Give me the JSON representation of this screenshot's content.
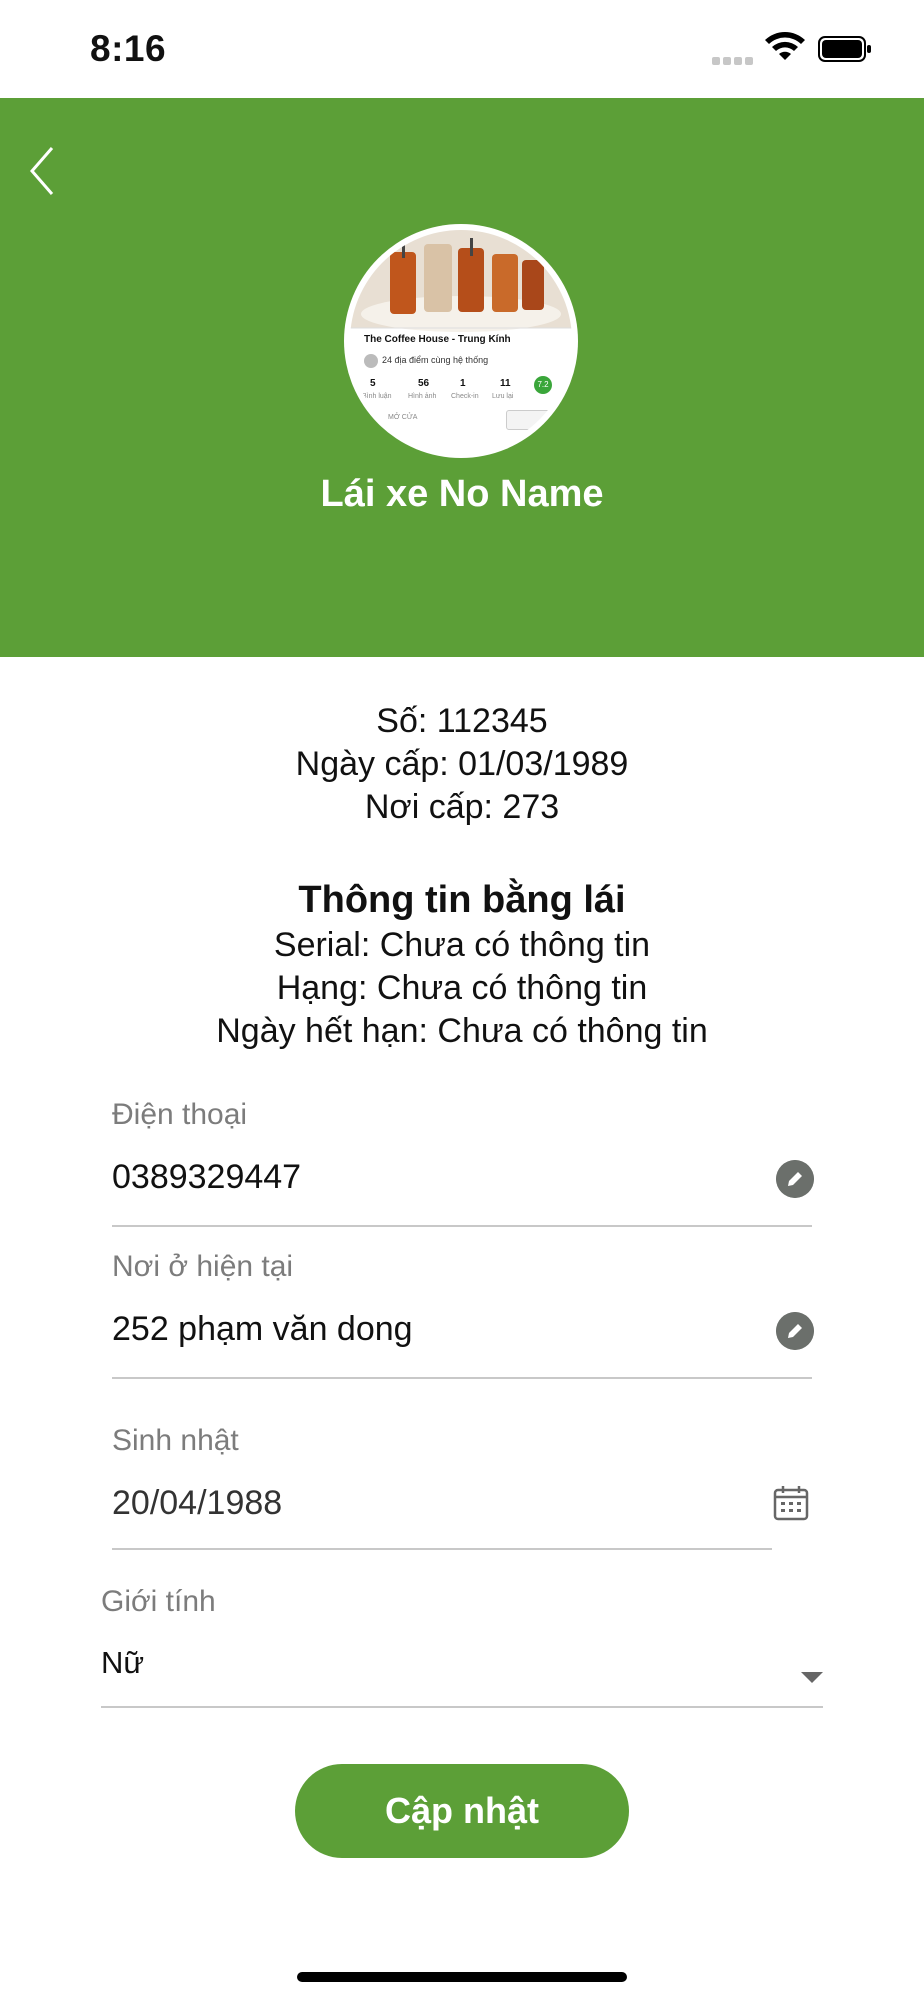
{
  "status_bar": {
    "time": "8:16"
  },
  "header": {
    "driver_name": "Lái xe No Name",
    "avatar": {
      "shop_name": "The Coffee House - Trung Kính",
      "locations_text": "24 địa điểm cùng hệ thống",
      "stats": [
        {
          "value": "5",
          "label": "Bình luận"
        },
        {
          "value": "56",
          "label": "Hình ảnh"
        },
        {
          "value": "1",
          "label": "Check-in"
        },
        {
          "value": "11",
          "label": "Lưu lại"
        }
      ],
      "rating": "7.2",
      "open_text": "MỞ CỬA"
    }
  },
  "identity": {
    "number": "Số: 112345",
    "issue_date": "Ngày cấp: 01/03/1989",
    "issue_place": "Nơi cấp: 273"
  },
  "license": {
    "title": "Thông tin bằng lái",
    "serial": "Serial: Chưa có thông tin",
    "class": "Hạng: Chưa có thông tin",
    "expiry": "Ngày hết hạn: Chưa có thông tin"
  },
  "form": {
    "phone": {
      "label": "Điện thoại",
      "value": "0389329447"
    },
    "address": {
      "label": "Nơi ở hiện tại",
      "value": "252 phạm văn dong"
    },
    "birthday": {
      "label": "Sinh nhật",
      "value": "20/04/1988"
    },
    "gender": {
      "label": "Giới tính",
      "value": "Nữ"
    }
  },
  "update_button": "Cập nhật",
  "colors": {
    "primary_green": "#5c9f37",
    "edit_icon": "#6b6f6b"
  }
}
